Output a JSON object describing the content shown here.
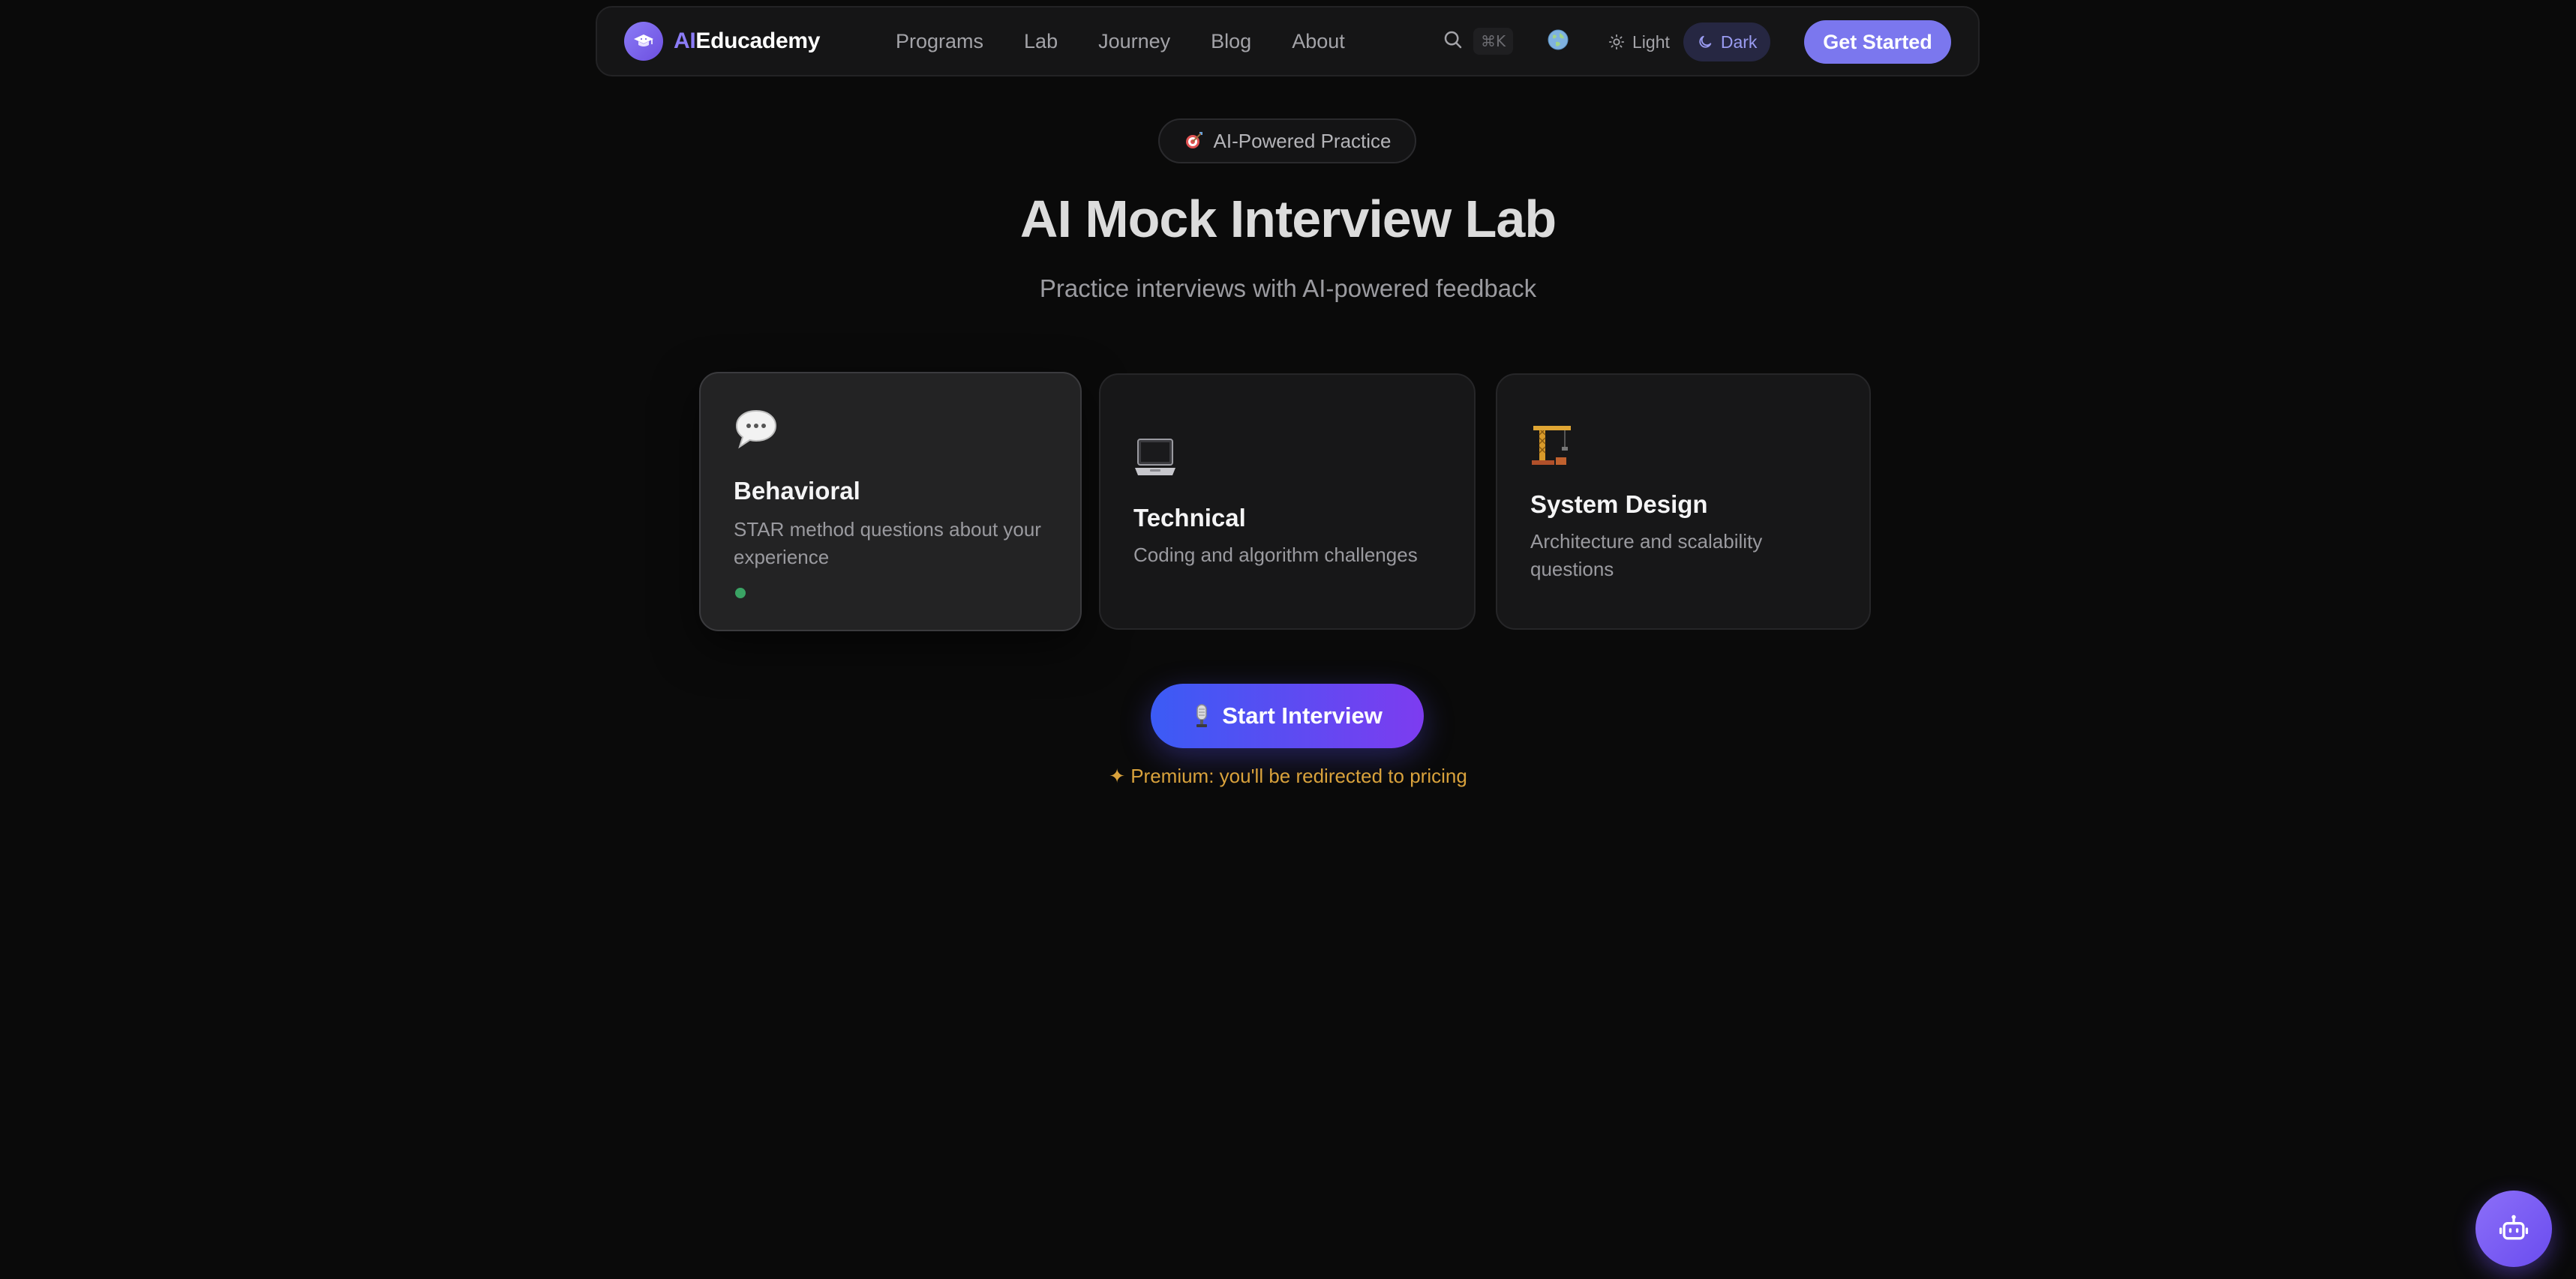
{
  "nav": {
    "brand_prefix": "AI",
    "brand_name": "Educademy",
    "links": [
      "Programs",
      "Lab",
      "Journey",
      "Blog",
      "About"
    ],
    "search_shortcut": "⌘K",
    "theme_light": "Light",
    "theme_dark": "Dark",
    "active_theme": "Dark",
    "cta": "Get Started"
  },
  "hero": {
    "badge": "AI-Powered Practice",
    "title": "AI Mock Interview Lab",
    "subtitle": "Practice interviews with AI-powered feedback"
  },
  "cards": [
    {
      "icon": "speech-bubble-icon",
      "title": "Behavioral",
      "description": "STAR method questions about your experience",
      "selected": true
    },
    {
      "icon": "laptop-icon",
      "title": "Technical",
      "description": "Coding and algorithm challenges",
      "selected": false
    },
    {
      "icon": "crane-icon",
      "title": "System Design",
      "description": "Architecture and scalability questions",
      "selected": false
    }
  ],
  "action": {
    "start_label": "Start Interview",
    "premium_note": "✦ Premium: you'll be redirected to pricing"
  },
  "colors": {
    "background": "#0a0a0a",
    "accent": "#7b77ee",
    "premium": "#d9a23c",
    "status_dot": "#3aa364"
  }
}
